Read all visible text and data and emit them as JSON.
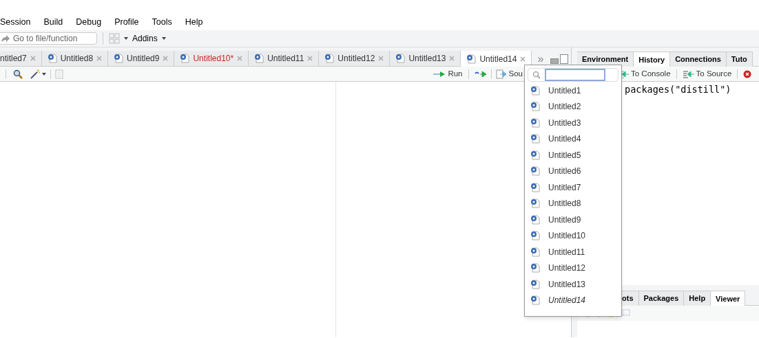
{
  "menu": [
    "Session",
    "Build",
    "Debug",
    "Profile",
    "Tools",
    "Help"
  ],
  "toolbar": {
    "goto_placeholder": "Go to file/function",
    "addins": "Addins"
  },
  "editor_tabs": [
    {
      "label": "ntitled7",
      "selected": false,
      "modified": false,
      "icon": false
    },
    {
      "label": "Untitled8",
      "selected": false,
      "modified": false,
      "icon": true
    },
    {
      "label": "Untitled9",
      "selected": false,
      "modified": false,
      "icon": true
    },
    {
      "label": "Untitled10*",
      "selected": false,
      "modified": true,
      "icon": true
    },
    {
      "label": "Untitled11",
      "selected": false,
      "modified": false,
      "icon": true
    },
    {
      "label": "Untitled12",
      "selected": false,
      "modified": false,
      "icon": true
    },
    {
      "label": "Untitled13",
      "selected": false,
      "modified": false,
      "icon": true
    },
    {
      "label": "Untitled14",
      "selected": true,
      "modified": false,
      "icon": true
    }
  ],
  "more_tabs": "»",
  "editor_toolbar": {
    "run": "Run",
    "source": "Sou"
  },
  "top_right_tabs": [
    {
      "label": "Environment",
      "selected": false
    },
    {
      "label": "History",
      "selected": true
    },
    {
      "label": "Connections",
      "selected": false
    },
    {
      "label": "Tuto",
      "selected": false
    }
  ],
  "history_toolbar": {
    "to_console": "To Console",
    "to_source": "To Source"
  },
  "history_lines": [
    "packages(\"distill\")"
  ],
  "bottom_right_tabs": [
    {
      "label": "ots",
      "selected": false
    },
    {
      "label": "Packages",
      "selected": false
    },
    {
      "label": "Help",
      "selected": false
    },
    {
      "label": "Viewer",
      "selected": true
    }
  ],
  "tab_list_popup": {
    "items": [
      {
        "label": "Untitled1",
        "current": false
      },
      {
        "label": "Untitled2",
        "current": false
      },
      {
        "label": "Untitled3",
        "current": false
      },
      {
        "label": "Untitled4",
        "current": false
      },
      {
        "label": "Untitled5",
        "current": false
      },
      {
        "label": "Untitled6",
        "current": false
      },
      {
        "label": "Untitled7",
        "current": false
      },
      {
        "label": "Untitled8",
        "current": false
      },
      {
        "label": "Untitled9",
        "current": false
      },
      {
        "label": "Untitled10",
        "current": false
      },
      {
        "label": "Untitled11",
        "current": false
      },
      {
        "label": "Untitled12",
        "current": false
      },
      {
        "label": "Untitled13",
        "current": false
      },
      {
        "label": "Untitled14",
        "current": true
      }
    ]
  }
}
